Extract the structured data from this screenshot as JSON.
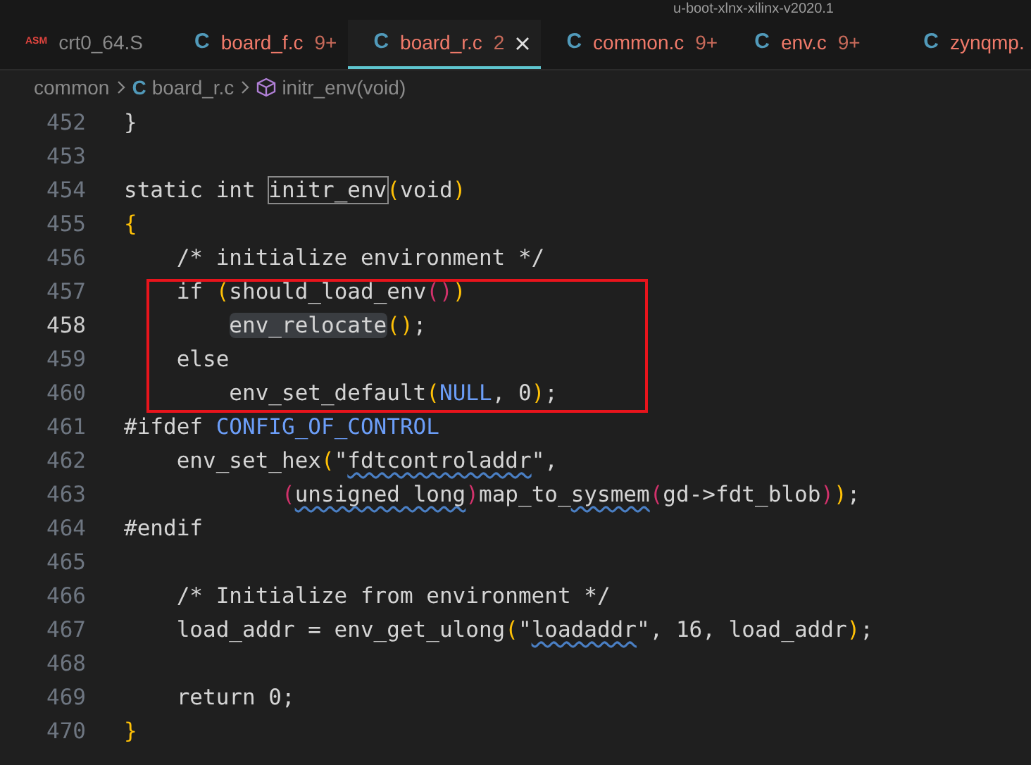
{
  "window": {
    "title": "u-boot-xlnx-xilinx-v2020.1"
  },
  "tabs": [
    {
      "icon": "ASM",
      "label": "crt0_64.S",
      "errors": false,
      "selected": false
    },
    {
      "icon": "C",
      "label": "board_f.c",
      "badge": "9+",
      "errors": true,
      "selected": false
    },
    {
      "icon": "C",
      "label": "board_r.c",
      "badge": "2",
      "errors": true,
      "selected": true
    },
    {
      "icon": "C",
      "label": "common.c",
      "badge": "9+",
      "errors": true,
      "selected": false
    },
    {
      "icon": "C",
      "label": "env.c",
      "badge": "9+",
      "errors": true,
      "selected": false
    },
    {
      "icon": "C",
      "label": "zynqmp.",
      "errors": true,
      "selected": false
    }
  ],
  "breadcrumbs": [
    {
      "kind": "folder",
      "label": "common"
    },
    {
      "kind": "file",
      "icon": "C",
      "label": "board_r.c"
    },
    {
      "kind": "symbol",
      "label": "initr_env(void)"
    }
  ],
  "editor": {
    "lines": [
      {
        "number": "452",
        "current": false,
        "boxed": false,
        "tokens": [
          {
            "t": "}",
            "kind": "plain"
          }
        ]
      },
      {
        "number": "453",
        "current": false,
        "boxed": false
      },
      {
        "number": "454",
        "current": false,
        "boxed": false,
        "tokens": [
          {
            "t": "static int ",
            "kind": "plain"
          },
          {
            "t": "initr_env",
            "kind": "plain",
            "outlined": true
          },
          {
            "t": "(",
            "kind": "bracket1"
          },
          {
            "t": "void",
            "kind": "plain"
          },
          {
            "t": ")",
            "kind": "bracket1"
          }
        ]
      },
      {
        "number": "455",
        "current": false,
        "boxed": false,
        "tokens": [
          {
            "t": "{",
            "kind": "bracket1"
          }
        ]
      },
      {
        "number": "456",
        "current": false,
        "boxed": false,
        "tokens": [
          {
            "t": "    /* initialize environment */",
            "kind": "plain"
          }
        ]
      },
      {
        "number": "457",
        "current": false,
        "boxed": true,
        "tokens": [
          {
            "t": "    if ",
            "kind": "plain"
          },
          {
            "t": "(",
            "kind": "bracket1"
          },
          {
            "t": "should_load_env",
            "kind": "plain"
          },
          {
            "t": "()",
            "kind": "bracket2"
          },
          {
            "t": ")",
            "kind": "bracket1"
          }
        ]
      },
      {
        "number": "458",
        "current": true,
        "boxed": true,
        "tokens": [
          {
            "t": "        env_relocate",
            "kind": "plain",
            "highlighted": true
          },
          {
            "t": "()",
            "kind": "bracket1"
          },
          {
            "t": ";",
            "kind": "plain"
          }
        ]
      },
      {
        "number": "459",
        "current": false,
        "boxed": true,
        "tokens": [
          {
            "t": "    else",
            "kind": "plain"
          }
        ]
      },
      {
        "number": "460",
        "current": false,
        "boxed": true,
        "tokens": [
          {
            "t": "        env_set_default",
            "kind": "plain"
          },
          {
            "t": "(",
            "kind": "bracket1"
          },
          {
            "t": "NULL",
            "kind": "macro"
          },
          {
            "t": ", 0",
            "kind": "plain"
          },
          {
            "t": ")",
            "kind": "bracket1"
          },
          {
            "t": ";",
            "kind": "plain"
          }
        ]
      },
      {
        "number": "461",
        "current": false,
        "boxed": false,
        "tokens": [
          {
            "t": "#ifdef ",
            "kind": "plain"
          },
          {
            "t": "CONFIG_OF_CONTROL",
            "kind": "macro"
          }
        ]
      },
      {
        "number": "462",
        "current": false,
        "boxed": false,
        "tokens": [
          {
            "t": "    env_set_hex",
            "kind": "plain"
          },
          {
            "t": "(",
            "kind": "bracket1"
          },
          {
            "t": "\"",
            "kind": "plain"
          },
          {
            "t": "fdtcontroladdr",
            "kind": "plain",
            "squiggle": true
          },
          {
            "t": "\",",
            "kind": "plain"
          }
        ]
      },
      {
        "number": "463",
        "current": false,
        "boxed": false,
        "tokens": [
          {
            "t": "            (",
            "kind": "bracket2"
          },
          {
            "t": "unsigned long",
            "kind": "plain",
            "squiggle": true
          },
          {
            "t": ")",
            "kind": "bracket2"
          },
          {
            "t": "map_to_",
            "kind": "plain"
          },
          {
            "t": "sysmem",
            "kind": "plain",
            "squiggle": true
          },
          {
            "t": "(",
            "kind": "bracket2"
          },
          {
            "t": "gd->fdt_blob",
            "kind": "plain"
          },
          {
            "t": ")",
            "kind": "bracket2"
          },
          {
            "t": ")",
            "kind": "bracket1"
          },
          {
            "t": ";",
            "kind": "plain"
          }
        ]
      },
      {
        "number": "464",
        "current": false,
        "boxed": false,
        "tokens": [
          {
            "t": "#endif",
            "kind": "plain"
          }
        ]
      },
      {
        "number": "465",
        "current": false,
        "boxed": false
      },
      {
        "number": "466",
        "current": false,
        "boxed": false,
        "tokens": [
          {
            "t": "    /* Initialize from environment */",
            "kind": "plain"
          }
        ]
      },
      {
        "number": "467",
        "current": false,
        "boxed": false,
        "tokens": [
          {
            "t": "    load_addr = env_get_ulong",
            "kind": "plain"
          },
          {
            "t": "(",
            "kind": "bracket1"
          },
          {
            "t": "\"",
            "kind": "plain"
          },
          {
            "t": "loadaddr",
            "kind": "plain",
            "squiggle": true
          },
          {
            "t": "\", 16, load_addr",
            "kind": "plain"
          },
          {
            "t": ")",
            "kind": "bracket1"
          },
          {
            "t": ";",
            "kind": "plain"
          }
        ]
      },
      {
        "number": "468",
        "current": false,
        "boxed": false
      },
      {
        "number": "469",
        "current": false,
        "boxed": false,
        "tokens": [
          {
            "t": "    return 0;",
            "kind": "plain"
          }
        ]
      },
      {
        "number": "470",
        "current": false,
        "boxed": false,
        "tokens": [
          {
            "t": "}",
            "kind": "bracket1"
          }
        ]
      }
    ]
  }
}
